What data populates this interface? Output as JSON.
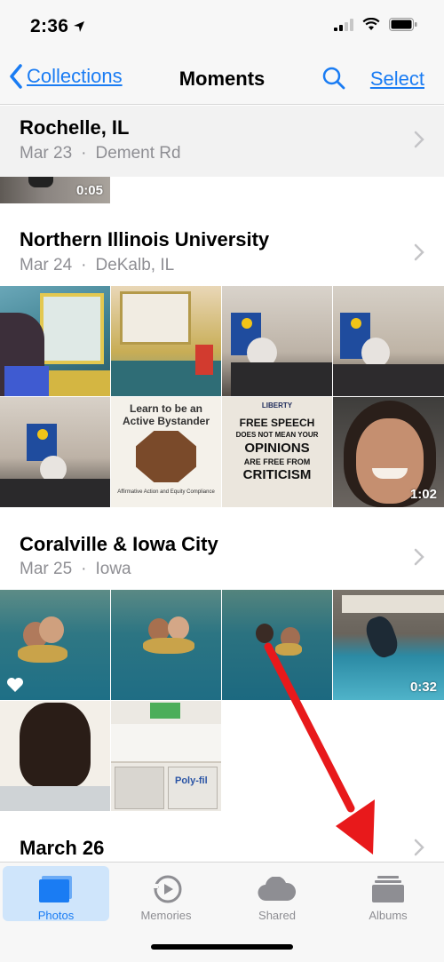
{
  "status_bar": {
    "time": "2:36"
  },
  "nav": {
    "back_label": "Collections",
    "title": "Moments",
    "select_label": "Select"
  },
  "moments": [
    {
      "title": "Rochelle, IL",
      "date": "Mar 23",
      "place": "Dement Rd",
      "video_duration": "0:05"
    },
    {
      "title": "Northern Illinois University",
      "date": "Mar 24",
      "place": "DeKalb, IL",
      "video_duration": "1:02"
    },
    {
      "title": "Coralville & Iowa City",
      "date": "Mar 25",
      "place": "Iowa",
      "video_duration": "0:32"
    },
    {
      "title": "March 26"
    }
  ],
  "photo_text": {
    "bystander": {
      "line1": "Learn to be an",
      "line2": "Active Bystander",
      "footer": "Affirmative Action and Equity Compliance"
    },
    "free_speech": {
      "header": "LIBERTY",
      "line1": "FREE SPEECH",
      "line2": "DOES NOT MEAN YOUR",
      "line3": "OPINIONS",
      "line4": "ARE FREE FROM",
      "line5": "CRITICISM"
    },
    "box_label": "Poly-fil"
  },
  "tabs": [
    {
      "label": "Photos",
      "icon": "photos-icon",
      "active": true
    },
    {
      "label": "Memories",
      "icon": "memories-icon",
      "active": false
    },
    {
      "label": "Shared",
      "icon": "cloud-icon",
      "active": false
    },
    {
      "label": "Albums",
      "icon": "albums-icon",
      "active": false
    }
  ],
  "colors": {
    "accent": "#1a7cf3",
    "secondary_text": "#8e8e93",
    "annotation_arrow": "#e8191b"
  }
}
